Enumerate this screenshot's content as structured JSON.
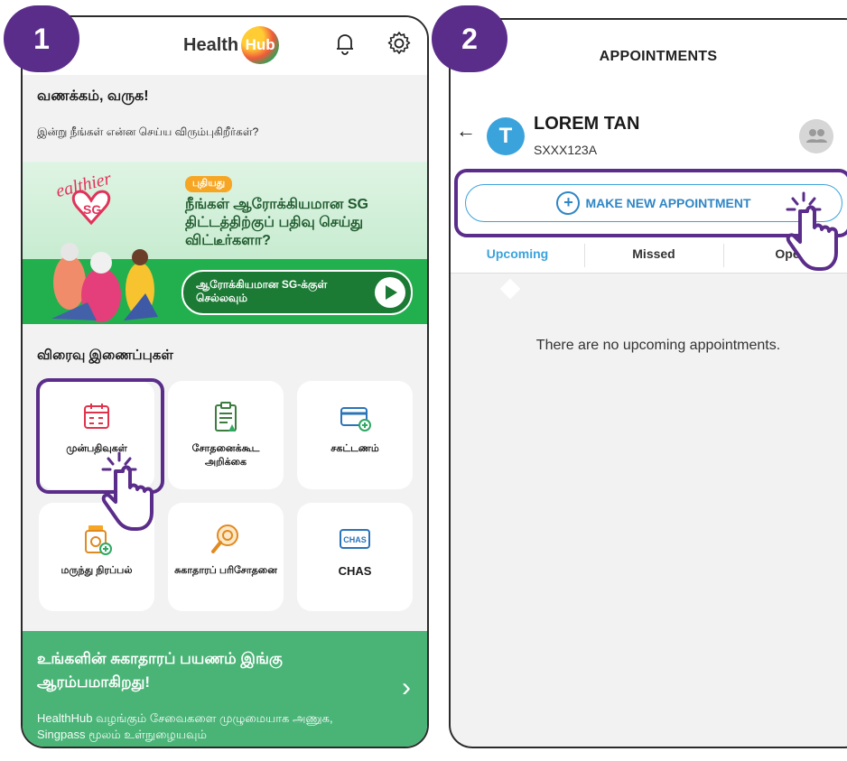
{
  "steps": {
    "one": "1",
    "two": "2"
  },
  "screen1": {
    "logo": {
      "text": "Health",
      "hub": "Hub"
    },
    "greeting": "வணக்கம், வருக!",
    "subtitle": "இன்று நீங்கள் என்ன செய்ய விரும்புகிறீர்கள்?",
    "banner": {
      "sg_badge_text": "Healthier SG",
      "tag": "புதியது",
      "title": "நீங்கள் ஆரோக்கியமான SG திட்டத்திற்குப் பதிவு செய்து விட்டீர்களா?",
      "button": "ஆரோக்கியமான SG-க்குள் செல்லவும்"
    },
    "quick_links_title": "விரைவு இணைப்புகள்",
    "tiles": [
      {
        "label": "முன்பதிவுகள்",
        "icon": "calendar-icon"
      },
      {
        "label": "சோதனைக்கூட அறிக்கை",
        "icon": "clipboard-icon"
      },
      {
        "label": "சகட்டணம்",
        "icon": "credit-card-icon"
      },
      {
        "label": "மருந்து நிரப்பல்",
        "icon": "medicine-bottle-icon"
      },
      {
        "label": "சுகாதாரப் பரிசோதனை",
        "icon": "magnifier-icon"
      },
      {
        "label": "CHAS",
        "icon": "chas-card-icon"
      }
    ],
    "footer": {
      "title": "உங்களின் சுகாதாரப் பயணம் இங்கு ஆரம்பமாகிறது!",
      "desc": "HealthHub வழங்கும் சேவைகளை முழுமையாக அணுக, Singpass மூலம்  உள்நுழையவும்"
    },
    "colors": {
      "accent": "#5b2d8a",
      "green": "#22b04e",
      "footer": "#4ab477"
    }
  },
  "screen2": {
    "title": "APPOINTMENTS",
    "patient": {
      "initial": "T",
      "name": "LOREM TAN",
      "id": "SXXX123A"
    },
    "make_button": "MAKE NEW APPOINTMENT",
    "tabs": [
      "Upcoming",
      "Missed",
      "Ope"
    ],
    "active_tab": "Upcoming",
    "empty_message": "There are no upcoming appointments.",
    "colors": {
      "accent": "#3aa3dc"
    }
  }
}
